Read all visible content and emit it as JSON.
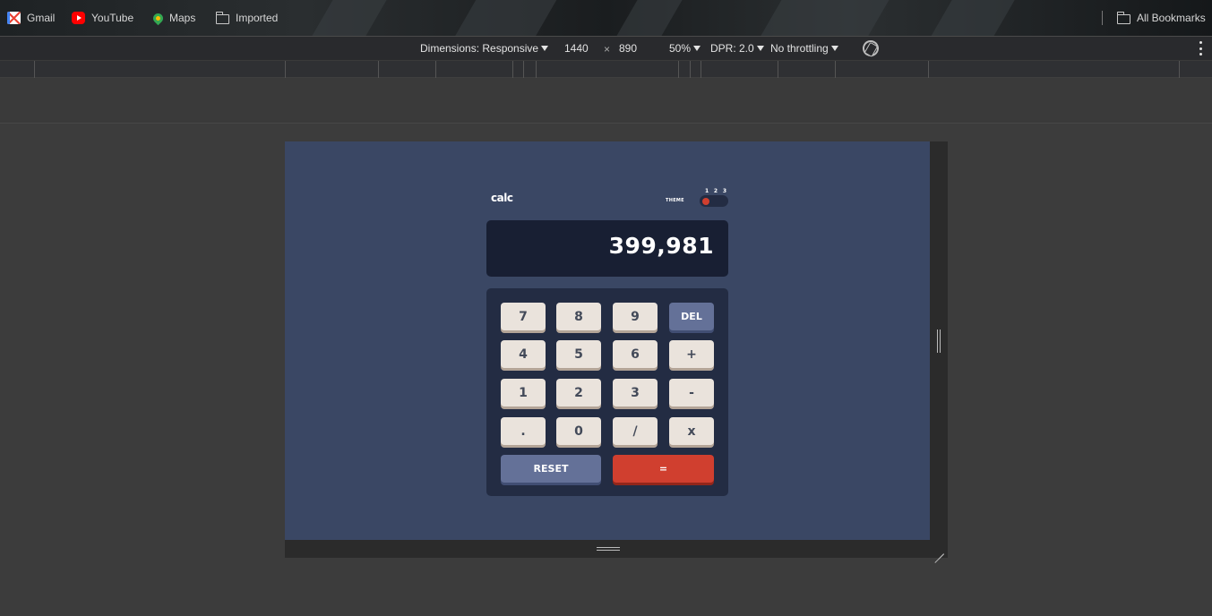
{
  "bookmarks": {
    "items": [
      {
        "label": "Gmail",
        "icon": "gmail-icon"
      },
      {
        "label": "YouTube",
        "icon": "youtube-icon"
      },
      {
        "label": "Maps",
        "icon": "maps-icon"
      },
      {
        "label": "Imported",
        "icon": "folder-icon"
      }
    ],
    "all_bookmarks": {
      "label": "All Bookmarks",
      "icon": "folder-icon"
    }
  },
  "devtools": {
    "dimensions_label": "Dimensions: Responsive",
    "width_value": "1440",
    "times_symbol": "×",
    "height_value": "890",
    "zoom": "50%",
    "dpr": "DPR: 2.0",
    "throttling": "No throttling"
  },
  "calculator": {
    "logo": "calc",
    "theme_label": "THEME",
    "theme_options": [
      "1",
      "2",
      "3"
    ],
    "active_theme": 1,
    "display": "399,981",
    "keys": {
      "k7": "7",
      "k8": "8",
      "k9": "9",
      "del": "DEL",
      "k4": "4",
      "k5": "5",
      "k6": "6",
      "plus": "+",
      "k1": "1",
      "k2": "2",
      "k3": "3",
      "minus": "-",
      "dot": ".",
      "k0": "0",
      "divide": "/",
      "multiply": "x",
      "reset": "RESET",
      "equals": "="
    },
    "colors": {
      "background": "#3a4764",
      "screen": "#181f33",
      "keypad": "#232c43",
      "key": "#eae3dc",
      "key_blue": "#647198",
      "key_red": "#d03f2f"
    }
  }
}
